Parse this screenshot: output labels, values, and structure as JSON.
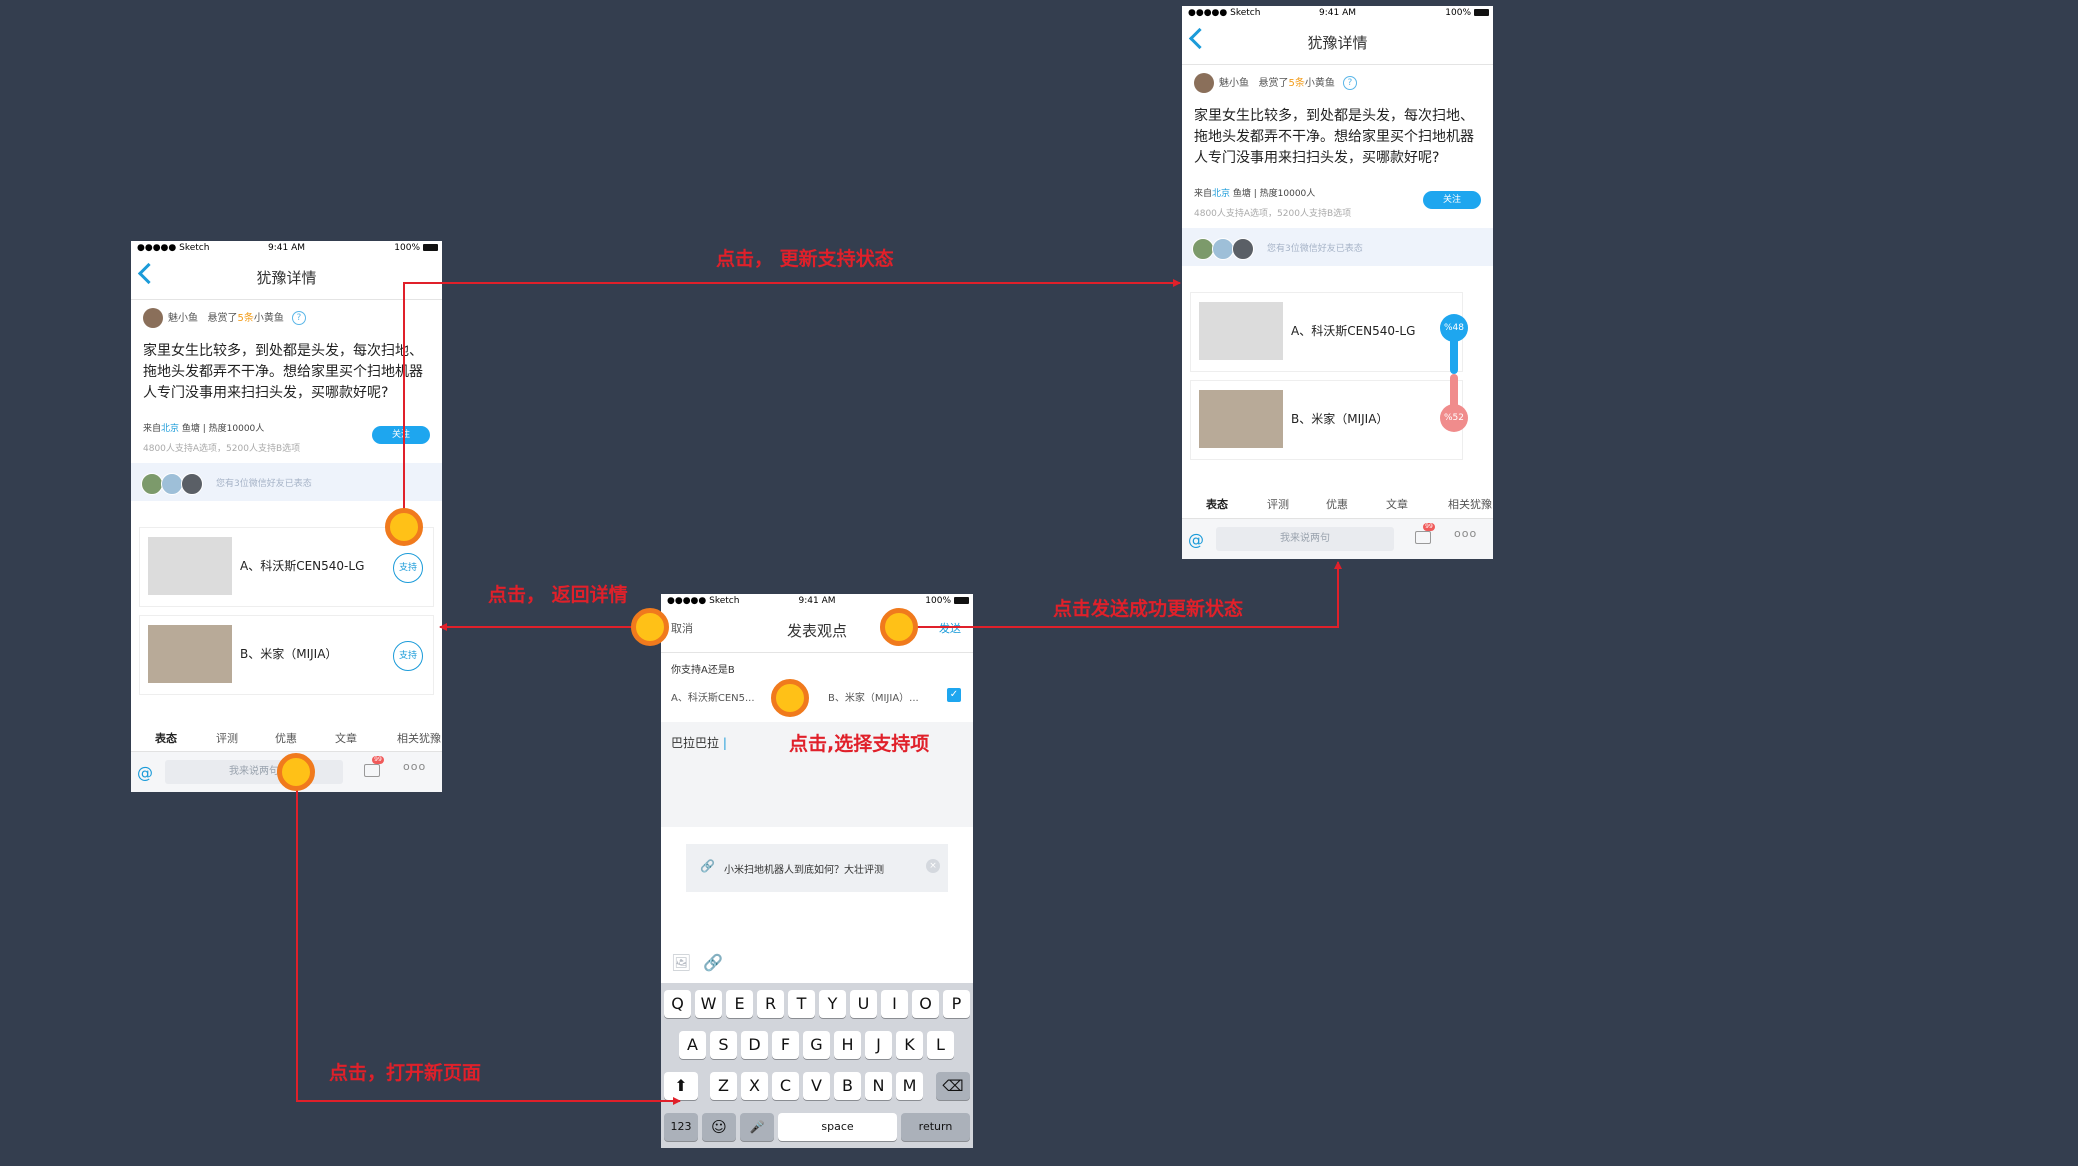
{
  "status_bar": {
    "carrier": "●●●●● Sketch",
    "time": "9:41 AM",
    "battery": "100%"
  },
  "detail": {
    "title": "犹豫详情",
    "author_name": "魅小鱼",
    "reward_prefix": "悬赏了",
    "reward_count": "5条",
    "reward_suffix": "小黄鱼",
    "help_icon": "?",
    "question": "家里女生比较多，到处都是头发，每次扫地、拖地头发都弄不干净。想给家里买个扫地机器人专门没事用来扫扫头发，买哪款好呢?",
    "from_prefix": "来自",
    "city": "北京",
    "from_suffix": " 鱼塘 | 热度10000人",
    "support_stats": "4800人支持A选项，5200人支持B选项",
    "follow": "关注",
    "friends_text": "您有3位微信好友已表态",
    "option_a": "A、科沃斯CEN540-LG",
    "option_b": "B、米家（MIJIA）",
    "support_btn": "支持",
    "percent_a": "%48",
    "percent_b": "%52",
    "tabs": [
      "表态",
      "评测",
      "优惠",
      "文章",
      "相关犹豫"
    ],
    "comment_placeholder": "我来说两句",
    "at_icon": "@",
    "badge": "99",
    "more_icon": "ooo"
  },
  "compose": {
    "cancel": "取消",
    "title": "发表观点",
    "send": "发送",
    "ask": "你支持A还是B",
    "choice_a": "A、科沃斯CEN5...",
    "choice_b": "B、米家（MIJIA）...",
    "checkmark": "✓",
    "text": "巴拉巴拉",
    "cursor": "|",
    "link_icon": "🔗",
    "link_title": "小米扫地机器人到底如何？大壮评测",
    "close_icon": "×",
    "image_icon": "🖼",
    "keyboard": {
      "row1": [
        "Q",
        "W",
        "E",
        "R",
        "T",
        "Y",
        "U",
        "I",
        "O",
        "P"
      ],
      "row2": [
        "A",
        "S",
        "D",
        "F",
        "G",
        "H",
        "J",
        "K",
        "L"
      ],
      "row3": [
        "Z",
        "X",
        "C",
        "V",
        "B",
        "N",
        "M"
      ],
      "shift": "⬆",
      "delete": "⌫",
      "numbers": "123",
      "emoji": "☺",
      "mic": "🎤",
      "space": "space",
      "return": "return"
    }
  },
  "annotations": {
    "update_support": "点击，  更新支持状态",
    "back_detail": "点击， 返回详情",
    "send_success": "点击发送成功更新状态",
    "select_option": "点击,选择支持项",
    "open_page": "点击，打开新页面"
  },
  "colors": {
    "accent": "#1b9bd9",
    "arrow": "#e0202a",
    "marker": "#ffc117",
    "marker_ring": "#f07a1d",
    "background": "#343e4f"
  }
}
